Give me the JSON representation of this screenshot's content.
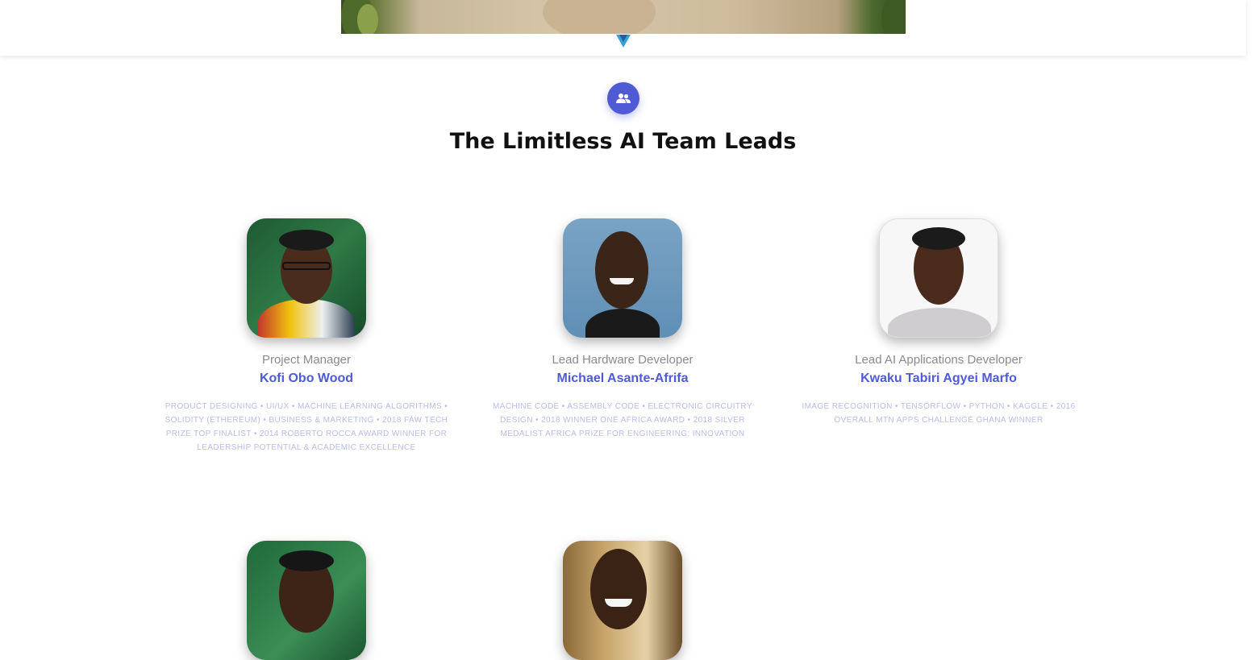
{
  "section": {
    "title": "The Limitless AI Team Leads",
    "icon": "team-icon",
    "accent_color": "#4f5bd5"
  },
  "members": [
    {
      "role": "Project Manager",
      "name": "Kofi Obo Wood",
      "skills": "PRODUCT DESIGNING • UI/UX • MACHINE LEARNING ALGORITHMS • SOLIDITY (ETHEREUM) • BUSINESS & MARKETING • 2018 FAW TECH PRIZE TOP FINALIST • 2014 ROBERTO ROCCA AWARD WINNER FOR LEADERSHIP POTENTIAL & ACADEMIC EXCELLENCE"
    },
    {
      "role": "Lead Hardware Developer",
      "name": "Michael Asante-Afrifa",
      "skills": "MACHINE CODE • ASSEMBLY CODE • ELECTRONIC CIRCUITRY DESIGN • 2018 WINNER ONE AFRICA AWARD • 2018 SILVER MEDALIST AFRICA PRIZE FOR ENGINEERING; INNOVATION"
    },
    {
      "role": "Lead AI Applications Developer",
      "name": "Kwaku Tabiri Agyei Marfo",
      "skills": "IMAGE RECOGNITION • TENSORFLOW • PYTHON • KAGGLE • 2016 OVERALL MTN APPS CHALLENGE GHANA WINNER"
    }
  ]
}
